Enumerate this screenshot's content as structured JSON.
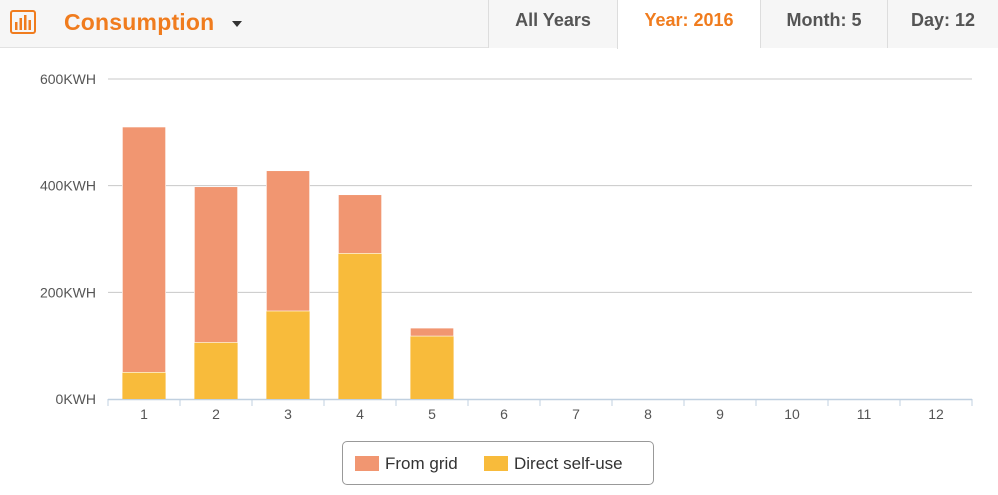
{
  "header": {
    "title": "Consumption",
    "icon": "bar-chart-icon",
    "dropdown_icon": "caret-down-icon",
    "tabs": [
      {
        "label": "All Years",
        "active": false
      },
      {
        "label": "Year: 2016",
        "active": true
      },
      {
        "label": "Month: 5",
        "active": false
      },
      {
        "label": "Day: 12",
        "active": false
      }
    ]
  },
  "colors": {
    "accent": "#f07c1e",
    "from_grid": "#f19671",
    "direct_self_use": "#f8bb3b",
    "gridline": "#c8c8c8",
    "axis": "#c0d0e0"
  },
  "chart_data": {
    "type": "bar",
    "stacked": true,
    "categories": [
      "1",
      "2",
      "3",
      "4",
      "5",
      "6",
      "7",
      "8",
      "9",
      "10",
      "11",
      "12"
    ],
    "series": [
      {
        "name": "From grid",
        "values": [
          460,
          292,
          263,
          110,
          15,
          0,
          0,
          0,
          0,
          0,
          0,
          0
        ]
      },
      {
        "name": "Direct self-use",
        "values": [
          50,
          106,
          165,
          273,
          118,
          0,
          0,
          0,
          0,
          0,
          0,
          0
        ]
      }
    ],
    "yticks": [
      "0KWH",
      "200KWH",
      "400KWH",
      "600KWH"
    ],
    "ytick_values": [
      0,
      200,
      400,
      600
    ],
    "ylim": [
      0,
      600
    ],
    "grid": true,
    "legend_position": "bottom-center"
  }
}
